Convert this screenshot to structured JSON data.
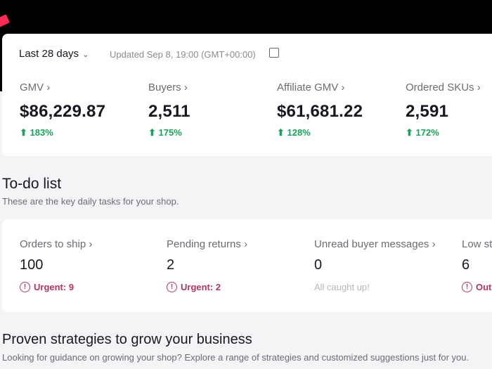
{
  "header": {
    "range": "Last 28 days",
    "updated": "Updated Sep 8, 19:00 (GMT+00:00)"
  },
  "metrics": [
    {
      "label": "GMV",
      "value": "$86,229.87",
      "change": "183%"
    },
    {
      "label": "Buyers",
      "value": "2,511",
      "change": "175%"
    },
    {
      "label": "Affiliate GMV",
      "value": "$61,681.22",
      "change": "128%"
    },
    {
      "label": "Ordered SKUs",
      "value": "2,591",
      "change": "172%"
    }
  ],
  "todo": {
    "title": "To-do list",
    "subtitle": "These are the key daily tasks for your shop.",
    "tasks": [
      {
        "label": "Orders to ship",
        "value": "100",
        "status": "Urgent: 9"
      },
      {
        "label": "Pending returns",
        "value": "2",
        "status": "Urgent: 2"
      },
      {
        "label": "Unread buyer messages",
        "value": "0",
        "status": "All caught up!"
      },
      {
        "label": "Low st",
        "value": "6",
        "status": "Out"
      }
    ]
  },
  "strategies": {
    "title": "Proven strategies to grow your business",
    "subtitle": "Looking for guidance on growing your shop? Explore a range of strategies and customized suggestions just for you."
  }
}
